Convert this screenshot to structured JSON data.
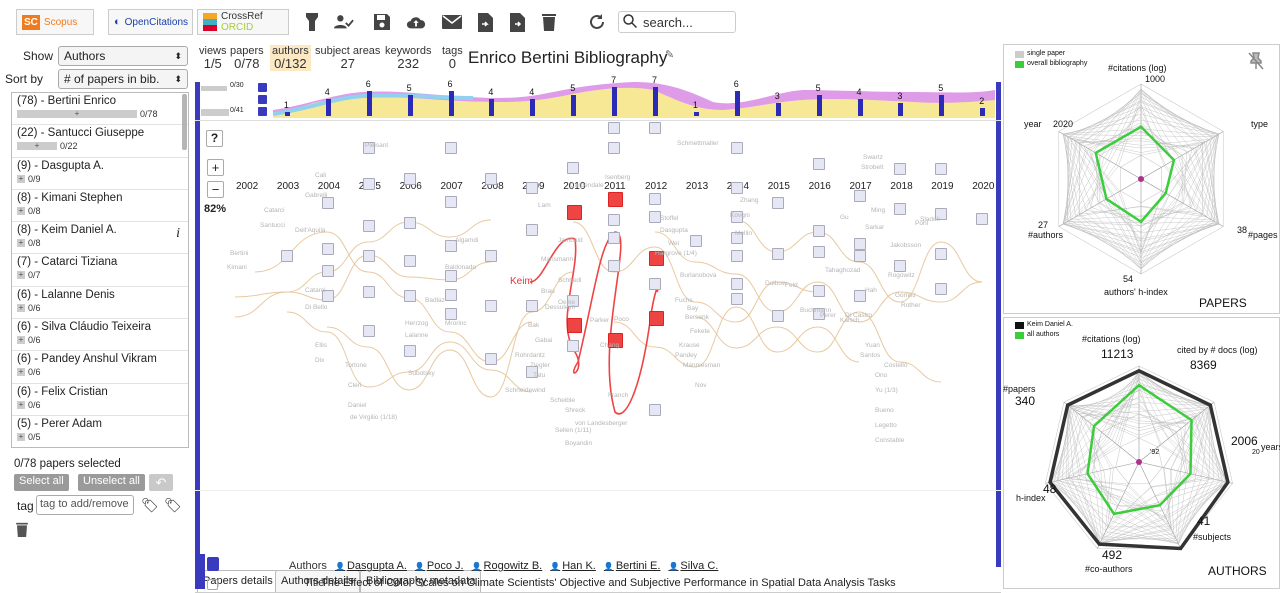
{
  "toolbar": {
    "scopus": "Scopus",
    "opencitations": "OpenCitations",
    "crossref": "CrossRef",
    "orcid": "ORCID",
    "search_placeholder": "search..."
  },
  "left": {
    "show_label": "Show",
    "show_value": "Authors",
    "sortby_label": "Sort by",
    "sortby_value": "# of papers in bib.",
    "authors": [
      {
        "name": "(78) - Bertini Enrico",
        "count": "0/78"
      },
      {
        "name": "(22) - Santucci Giuseppe",
        "count": "0/22"
      },
      {
        "name": "(9) - Dasgupta A.",
        "count": "0/9"
      },
      {
        "name": "(8) - Kimani Stephen",
        "count": "0/8"
      },
      {
        "name": "(8) - Keim Daniel A.",
        "count": "0/8"
      },
      {
        "name": "(7) - Catarci Tiziana",
        "count": "0/7"
      },
      {
        "name": "(6) - Lalanne Denis",
        "count": "0/6"
      },
      {
        "name": "(6) - Silva Cláudio Teixeira",
        "count": "0/6"
      },
      {
        "name": "(6) - Pandey Anshul Vikram",
        "count": "0/6"
      },
      {
        "name": "(6) - Felix Cristian",
        "count": "0/6"
      },
      {
        "name": "(5) - Perer Adam",
        "count": "0/5"
      }
    ],
    "info_symbol": "i",
    "selected_text": "0/78 papers selected",
    "select_all": "Select all",
    "unselect_all": "Unselect all",
    "tag_label": "tag",
    "tag_placeholder": "tag to add/remove"
  },
  "center": {
    "stats": [
      {
        "label": "views",
        "value": "1/5"
      },
      {
        "label": "papers",
        "value": "0/78"
      },
      {
        "label": "authors",
        "value": "0/132"
      },
      {
        "label": "subject areas",
        "value": "27"
      },
      {
        "label": "keywords",
        "value": "232"
      },
      {
        "label": "tags",
        "value": "0"
      }
    ],
    "title": "Enrico Bertini Bibliography",
    "mini_labels": [
      "0/30",
      "0/41"
    ],
    "bar_counts": [
      {
        "year": "2003",
        "value": 1
      },
      {
        "year": "2004",
        "value": 4
      },
      {
        "year": "2005",
        "value": 6
      },
      {
        "year": "2006",
        "value": 5
      },
      {
        "year": "2007",
        "value": 6
      },
      {
        "year": "2008",
        "value": 4
      },
      {
        "year": "2009",
        "value": 4
      },
      {
        "year": "2010",
        "value": 5
      },
      {
        "year": "2011",
        "value": 7
      },
      {
        "year": "2012",
        "value": 7
      },
      {
        "year": "2013",
        "value": 1
      },
      {
        "year": "2014",
        "value": 6
      },
      {
        "year": "2015",
        "value": 3
      },
      {
        "year": "2016",
        "value": 5
      },
      {
        "year": "2017",
        "value": 4
      },
      {
        "year": "2018",
        "value": 3
      },
      {
        "year": "2019",
        "value": 5
      },
      {
        "year": "2020",
        "value": 2
      }
    ],
    "years": [
      "2002",
      "2003",
      "2004",
      "2005",
      "2006",
      "2007",
      "2008",
      "2009",
      "2010",
      "2011",
      "2012",
      "2013",
      "2014",
      "2015",
      "2016",
      "2017",
      "2018",
      "2019",
      "2020"
    ],
    "help": "?",
    "zoom_in": "+",
    "zoom_out": "−",
    "zoom_level": "82%",
    "keim_label": "Keim",
    "author_labels": [
      "Pleisant",
      "Cali",
      "Gabrelli",
      "Catarci",
      "Santucci",
      "Dell'Aquila",
      "Bertini",
      "Kimani",
      "Catarci",
      "Di Bello",
      "Ellis",
      "Dix",
      "Tortone",
      "Cleri",
      "Daniel",
      "de Virgilio (1/18)",
      "Subotsky",
      "Herrzog",
      "Lalanne",
      "Badlaz",
      "Mrorinc",
      "Baldonado",
      "Algamdi",
      "Lam",
      "Jambald",
      "Mansmann",
      "Schbedl",
      "Brau",
      "Oelke",
      "Dessuleyn",
      "Bak",
      "Gabai",
      "Ziegler",
      "Tatu",
      "Schneidewind",
      "Rohrdantz",
      "Carpendale",
      "Isenberg",
      "Scheible",
      "Shreck",
      "von Landesberger",
      "Sellen (1/11)",
      "Boyandin",
      "Parker",
      "Stoffel",
      "Dasgupta",
      "Wei",
      "Hargrove (1/4)",
      "Burlanobova",
      "Fuchs",
      "Bay",
      "Bersenk",
      "Fekete",
      "Krause",
      "Pandey",
      "Manniesman",
      "Nov",
      "Schmettmaller",
      "Poco",
      "Chang",
      "Franch",
      "Zhang",
      "Kovgni",
      "Mellin",
      "Dolbow",
      "Feld",
      "Buchmann",
      "Tahaghozad",
      "Perer",
      "Kalsch",
      "Swartz",
      "Strobelt",
      "Ming",
      "Gu",
      "Sladek",
      "Sarkar",
      "Pohl",
      "Jakobsson",
      "Rogowitz",
      "Hah",
      "Di Castro",
      "Gomez",
      "Rother",
      "Yuan",
      "Santos",
      "Costello",
      "Ono",
      "Yu (1/3)",
      "Bueno",
      "Legetto",
      "Constable"
    ]
  },
  "tabs": {
    "papers": "Papers details",
    "authors": "Authors details",
    "metadata": "Bibliography metadata"
  },
  "paper": {
    "authors_label": "Authors",
    "authors": [
      "Dasgupta A.",
      "Poco J.",
      "Rogowitz B.",
      "Han K.",
      "Bertini E.",
      "Silva C."
    ],
    "title_label": "Title",
    "title": "The Effect of Color Scales on Climate Scientists' Objective and Subjective Performance in Spatial Data Analysis Tasks"
  },
  "papers_radar": {
    "legend_single": "single paper",
    "legend_overall": "overall bibliography",
    "axis_citations": "#citations (log)",
    "axis_type": "type",
    "axis_pages": "#pages",
    "axis_hindex": "authors' h-index",
    "axis_authors": "#authors",
    "axis_year": "year",
    "val_citations": "1000",
    "val_year": "2020",
    "val_authors": "27",
    "val_pages": "38",
    "val_hindex": "54",
    "heading": "PAPERS"
  },
  "authors_radar": {
    "legend_keim": "Keim Daniel A.",
    "legend_all": "all authors",
    "axis_citations": "#citations (log)",
    "axis_citedby": "cited by # docs (log)",
    "axis_years": "years",
    "axis_subjects": "#subjects",
    "axis_coauthors": "#co-authors",
    "axis_hindex": "h-index",
    "axis_papers": "#papers",
    "val_citations": "11213",
    "val_citedby": "8369",
    "val_years": "2006",
    "val_years_20": "20",
    "val_92": "'92",
    "val_subjects": "41",
    "val_coauthors": "492",
    "val_hindex": "48",
    "val_papers": "340",
    "heading": "AUTHORS"
  },
  "colors": {
    "bar": "#2b2bb7",
    "highlight": "#ee4444",
    "green": "#3ccc3c",
    "authors_active_bg": "#fde8c4",
    "grey_button": "#9a9a9a"
  }
}
